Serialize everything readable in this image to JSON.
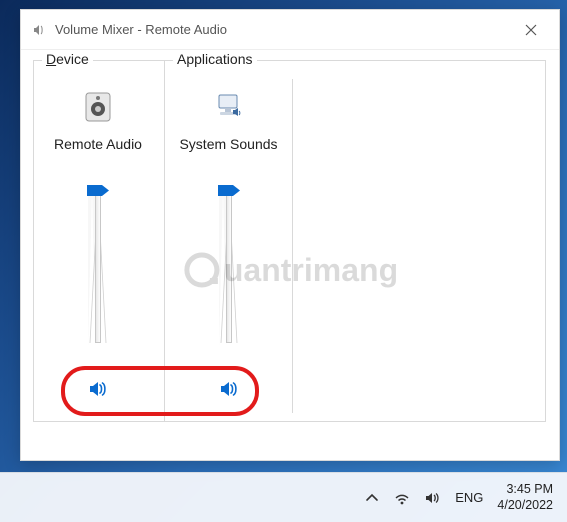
{
  "window": {
    "title": "Volume Mixer - Remote Audio"
  },
  "groups": {
    "device_label": "evice",
    "device_prefix": "D",
    "applications_label": "Applications"
  },
  "device": {
    "name": "Remote Audio",
    "volume": 100,
    "muted": false
  },
  "applications": [
    {
      "name": "System Sounds",
      "volume": 100,
      "muted": false
    }
  ],
  "taskbar": {
    "language": "ENG",
    "time": "3:45 PM",
    "date": "4/20/2022"
  },
  "watermark": {
    "text": "uantrimang"
  },
  "colors": {
    "accent": "#0a6bcf",
    "annotation": "#e21b1b"
  }
}
